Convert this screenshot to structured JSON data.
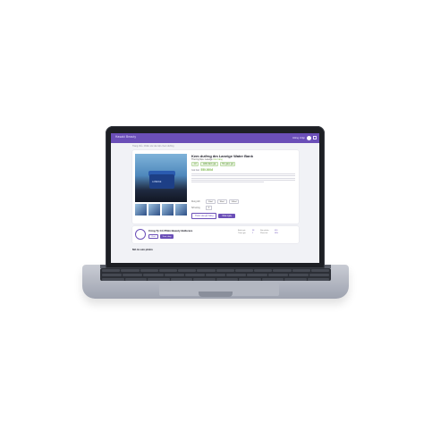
{
  "topbar": {
    "brand": "Hasaki Beauty",
    "right_text": "Đăng nhập"
  },
  "breadcrumb": "Trang chủ › Chăm sóc da mặt › Kem dưỡng",
  "product": {
    "title": "Kem dưỡng ẩm Laneige Water Bank",
    "subtitle": "Thương hiệu: Laneige",
    "subtitle_highlight": "Còn hàng",
    "badges": [
      "4.8",
      "1280 đánh giá",
      "5% giảm giá"
    ],
    "price_label": "Giá bán:",
    "price": "550.000đ",
    "option_label": "Dung tích",
    "options": [
      "50ml",
      "80ml",
      "100ml"
    ],
    "qty_label": "Số lượng",
    "qty": "1",
    "add_to_cart": "Thêm vào giỏ hàng",
    "buy_now": "Mua ngay",
    "jar_text": "LANEIGE"
  },
  "shop": {
    "name": "Công Ty Cổ Phần Beauty Bulbcare",
    "chat_label": "Chat",
    "view_label": "Xem shop",
    "stats": [
      {
        "label": "Đánh giá",
        "value": "98"
      },
      {
        "label": "Sản phẩm",
        "value": "416"
      },
      {
        "label": "Tham gia",
        "value": "2"
      },
      {
        "label": "Phản hồi",
        "value": "98%"
      }
    ]
  },
  "more_title": "Mô tả sản phẩm",
  "colors": {
    "accent": "#6b4fb8",
    "success": "#7ab648"
  }
}
